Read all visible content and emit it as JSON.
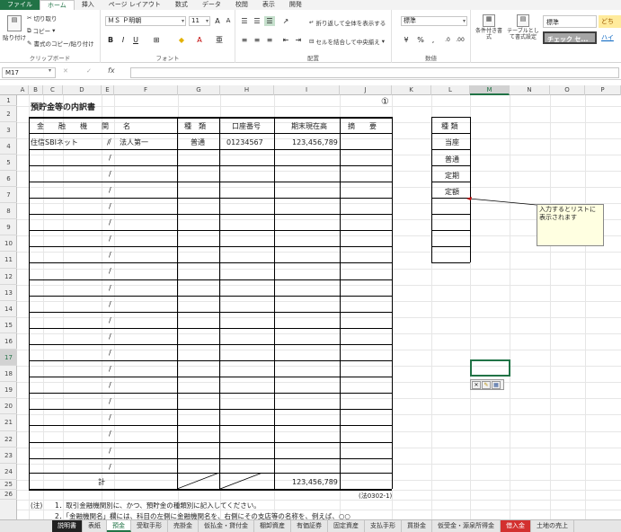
{
  "ribbon_tabs": [
    "ファイル",
    "ホーム",
    "挿入",
    "ページ レイアウト",
    "数式",
    "データ",
    "校閲",
    "表示",
    "開発"
  ],
  "clipboard": {
    "paste": "貼り付け",
    "cut": "切り取り",
    "copy": "コピー",
    "format_painter": "書式のコピー/貼り付け",
    "group": "クリップボード"
  },
  "font": {
    "name": "ＭＳ Ｐ明朝",
    "size": "11",
    "group": "フォント"
  },
  "alignment": {
    "wrap": "折り返して全体を表示する",
    "merge": "セルを結合して中央揃え",
    "group": "配置"
  },
  "number": {
    "format": "標準",
    "group": "数値"
  },
  "styles": {
    "conditional": "条件付き書式",
    "table": "テーブルとして書式設定",
    "normal": "標準",
    "check": "チェック セ...",
    "group2": "どち",
    "link": "ハイ"
  },
  "formula_bar": {
    "name_box": "M17",
    "fx": "fx"
  },
  "columns": [
    "A",
    "B",
    "C",
    "D",
    "E",
    "F",
    "G",
    "H",
    "I",
    "J",
    "K",
    "L",
    "M",
    "N",
    "O",
    "P"
  ],
  "rows": [
    "1",
    "2",
    "3",
    "4",
    "5",
    "6",
    "7",
    "8",
    "9",
    "10",
    "11",
    "12",
    "13",
    "14",
    "15",
    "16",
    "17",
    "18",
    "19",
    "20",
    "21",
    "22",
    "23",
    "24",
    "25",
    "26"
  ],
  "doc": {
    "title": "預貯金等の内訳書",
    "page_mark": "①",
    "headers": {
      "institution": "金　　融　　機　　関　　名",
      "type": "種　類",
      "account": "口座番号",
      "balance": "期末現在高",
      "remarks": "摘　　要"
    },
    "row1": {
      "bank": "住信SBIネット",
      "slash": "/",
      "branch": "法人第一",
      "type": "普通",
      "account": "01234567",
      "balance": "123,456,789"
    },
    "total_label": "計",
    "total_value": "123,456,789",
    "form_code": "(法0302-1)",
    "note_label": "(注)",
    "note1": "1．取引金融機関別に、かつ、預貯金の種類別に記入してください。",
    "note2": "2．「金融機関名」欄には、科目の左側に金融機関名を、右側にその支店等の名称を、例えば、○○"
  },
  "side_list": {
    "header": "種 類",
    "items": [
      "当座",
      "普通",
      "定期",
      "定額"
    ]
  },
  "comment": "入力するとリストに表示されます",
  "sheet_tabs": [
    "説明書",
    "表紙",
    "預金",
    "受取手形",
    "売掛金",
    "仮払金・貸付金",
    "棚卸資産",
    "有価証券",
    "固定資産",
    "支払手形",
    "買掛金",
    "仮受金・源泉所得金",
    "借入金",
    "土地の売上"
  ]
}
